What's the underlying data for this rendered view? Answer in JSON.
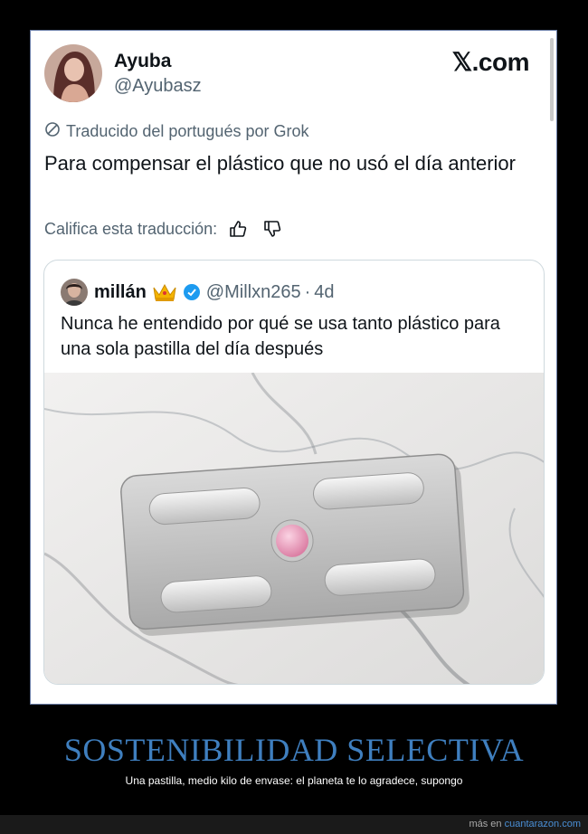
{
  "tweet": {
    "author_name": "Ayuba",
    "author_handle": "@Ayubasz",
    "site_logo": "𝕏.com",
    "translated_label": "Traducido del portugués por Grok",
    "text": "Para compensar el plástico que no usó el día anterior",
    "rate_label": "Califica esta traducción:",
    "icons": [
      "translate-icon",
      "thumbs-up-icon",
      "thumbs-down-icon"
    ]
  },
  "quoted": {
    "author_name": "millán",
    "handle": "@Millxn265",
    "separator": "·",
    "time": "4d",
    "text": "Nunca he entendido por qué se usa tanto plástico para una sola pastilla del día después",
    "icons": [
      "crown-icon",
      "verified-badge-icon"
    ]
  },
  "caption": {
    "title": "SOSTENIBILIDAD SELECTIVA",
    "subtitle": "Una pastilla, medio kilo de envase: el planeta te lo agradece, supongo"
  },
  "footer": {
    "prefix": "más en",
    "link": "cuantarazon.com"
  },
  "colors": {
    "background": "#000000",
    "title": "#3f7fbf",
    "verified": "#1d9bf0",
    "pill": "#e89bb8"
  }
}
